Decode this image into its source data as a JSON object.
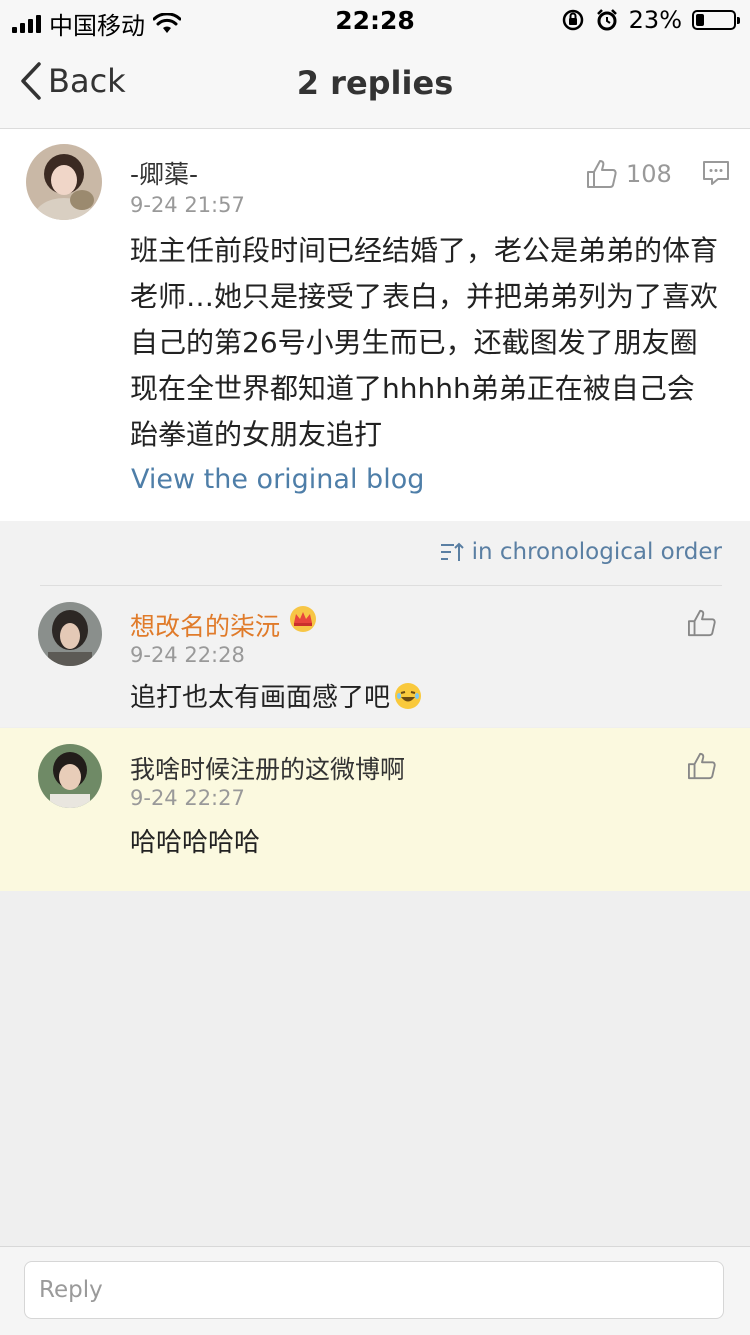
{
  "status_bar": {
    "carrier": "中国移动",
    "time": "22:28",
    "battery": "23%",
    "battery_level": 0.23
  },
  "nav": {
    "back_label": "Back",
    "title": "2 replies"
  },
  "main_comment": {
    "author": "-卿蕖-",
    "time": "9-24 21:57",
    "likes": "108",
    "text": "班主任前段时间已经结婚了，老公是弟弟的体育老师…她只是接受了表白，并把弟弟列为了喜欢自己的第26号小男生而已，还截图发了朋友圈现在全世界都知道了hhhhh弟弟正在被自己会跆拳道的女朋友追打",
    "link": "View the original blog"
  },
  "sort_label": "in chronological order",
  "replies": [
    {
      "author": "想改名的柒沅",
      "time": "9-24 22:28",
      "text": "追打也太有画面感了吧",
      "name_color": "#e07b2a"
    },
    {
      "author": "我啥时候注册的这微博啊",
      "time": "9-24 22:27",
      "text": "哈哈哈哈哈",
      "name_color": "#333333"
    }
  ],
  "reply_bar": {
    "placeholder": "Reply"
  }
}
